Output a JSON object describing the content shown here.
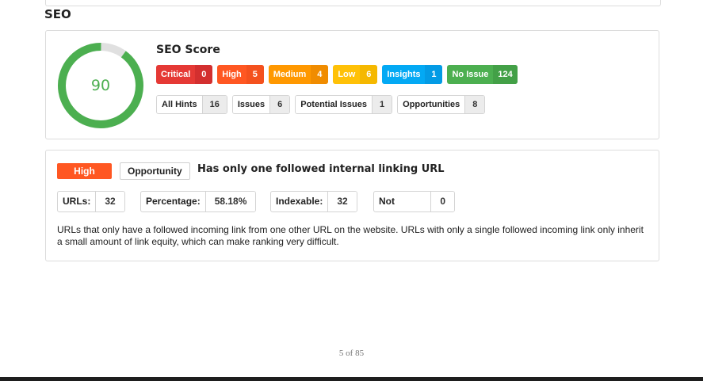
{
  "section": {
    "title": "SEO"
  },
  "score": {
    "title": "SEO Score",
    "value": "90",
    "fraction": 0.9,
    "gauge_color": "#4caf50",
    "track_color": "#e0e0e0"
  },
  "severities": [
    {
      "label": "Critical",
      "count": "0",
      "color": "#e53935"
    },
    {
      "label": "High",
      "count": "5",
      "color": "#ff5722"
    },
    {
      "label": "Medium",
      "count": "4",
      "color": "#ff9800"
    },
    {
      "label": "Low",
      "count": "6",
      "color": "#ffc107"
    },
    {
      "label": "Insights",
      "count": "1",
      "color": "#03a9f4"
    },
    {
      "label": "No Issue",
      "count": "124",
      "color": "#4caf50"
    }
  ],
  "counts": [
    {
      "label": "All Hints",
      "count": "16"
    },
    {
      "label": "Issues",
      "count": "6"
    },
    {
      "label": "Potential Issues",
      "count": "1"
    },
    {
      "label": "Opportunities",
      "count": "8"
    }
  ],
  "hint": {
    "priority": "High",
    "type": "Opportunity",
    "title": "Has only one followed internal linking URL",
    "stats": [
      {
        "label": "URLs:",
        "value": "32"
      },
      {
        "label": "Percentage:",
        "value": "58.18%"
      },
      {
        "label": "Indexable:",
        "value": "32"
      },
      {
        "label": "Not Indexable:",
        "value": "0"
      }
    ],
    "description": "URLs that only have a followed incoming link from one other URL on the website. URLs with only a single followed incoming link only inherit a small amount of link equity, which can make ranking very difficult."
  },
  "footer": {
    "page_label": "5 of 85"
  }
}
